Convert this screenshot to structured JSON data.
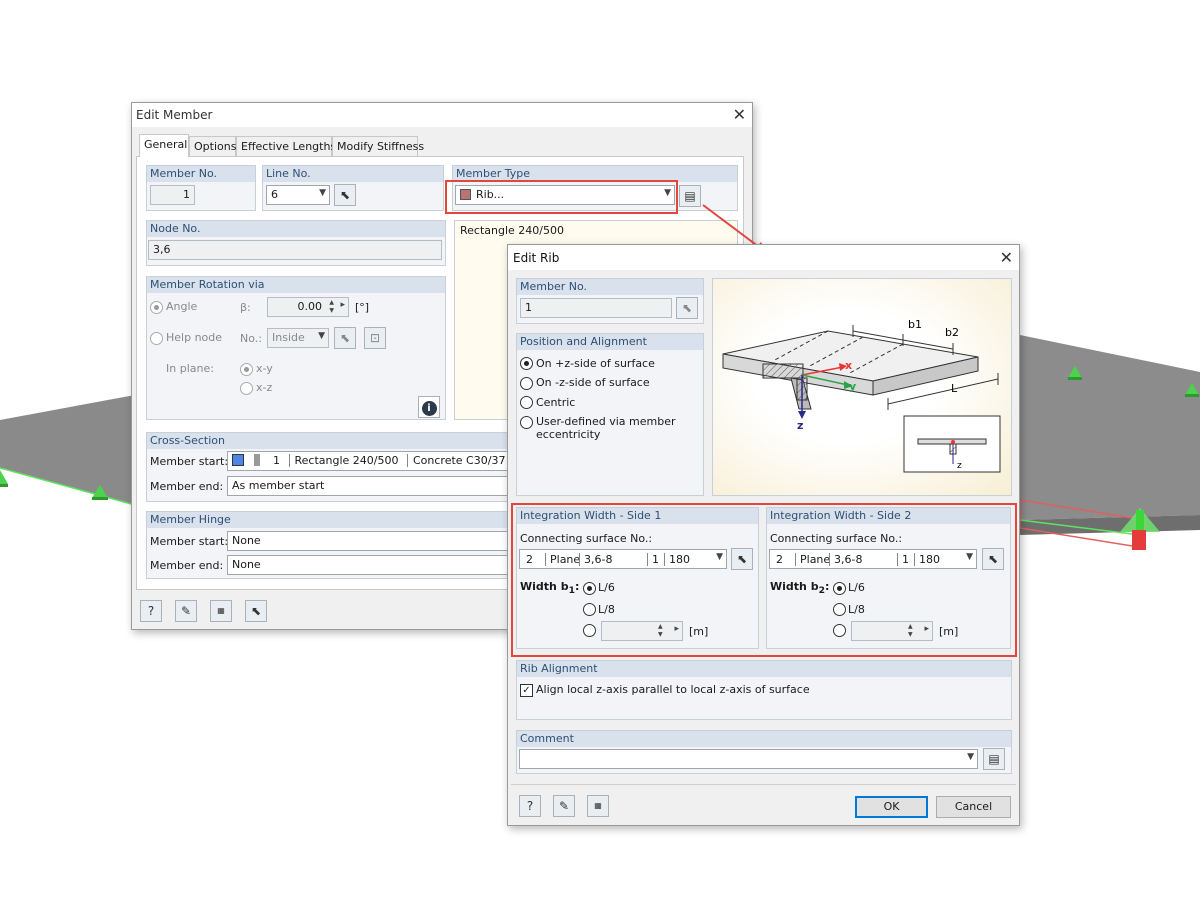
{
  "edit_member": {
    "title": "Edit Member",
    "tabs": [
      "General",
      "Options",
      "Effective Lengths",
      "Modify Stiffness"
    ],
    "member_no_label": "Member No.",
    "member_no": "1",
    "line_no_label": "Line No.",
    "line_no": "6",
    "member_type_label": "Member Type",
    "member_type": "Rib...",
    "node_no_label": "Node No.",
    "node_no": "3,6",
    "info_text": "Rectangle 240/500",
    "rotation": {
      "header": "Member Rotation via",
      "angle_label": "Angle",
      "beta_label": "β:",
      "beta_value": "0.00",
      "unit": "[°]",
      "help_node_label": "Help node",
      "no_label": "No.:",
      "no_value": "Inside",
      "in_plane_label": "In plane:",
      "xy": "x-y",
      "xz": "x-z"
    },
    "cross_section": {
      "header": "Cross-Section",
      "start_label": "Member start:",
      "start_no": "1",
      "start_name": "Rectangle 240/500",
      "start_material": "Concrete C30/37",
      "end_label": "Member end:",
      "end_value": "As member start"
    },
    "hinge": {
      "header": "Member Hinge",
      "start_label": "Member start:",
      "start_value": "None",
      "end_label": "Member end:",
      "end_value": "None"
    }
  },
  "edit_rib": {
    "title": "Edit Rib",
    "member_no_label": "Member No.",
    "member_no": "1",
    "position": {
      "header": "Position and Alignment",
      "options": [
        "On +z-side of surface",
        "On -z-side of surface",
        "Centric",
        "User-defined via member eccentricity"
      ],
      "selected": 0
    },
    "figure": {
      "b1": "b1",
      "b2": "b2",
      "L": "L",
      "x": "x",
      "y": "y",
      "z": "z",
      "z2": "z"
    },
    "side1": {
      "header": "Integration Width - Side 1",
      "conn_label": "Connecting surface No.:",
      "no": "2",
      "type": "Plane",
      "nodes": "3,6-8",
      "n": "1",
      "val": "180",
      "width_label": "Width b",
      "width_sub": "1",
      "opt1": "L/6",
      "opt2": "L/8",
      "unit": "[m]"
    },
    "side2": {
      "header": "Integration Width - Side 2",
      "conn_label": "Connecting surface No.:",
      "no": "2",
      "type": "Plane",
      "nodes": "3,6-8",
      "n": "1",
      "val": "180",
      "width_label": "Width b",
      "width_sub": "2",
      "opt1": "L/6",
      "opt2": "L/8",
      "unit": "[m]"
    },
    "rib_alignment": {
      "header": "Rib Alignment",
      "checkbox_label": "Align local z-axis parallel to local z-axis of surface",
      "checked": true
    },
    "comment": {
      "header": "Comment",
      "value": ""
    },
    "ok_label": "OK",
    "cancel_label": "Cancel"
  },
  "colors": {
    "accent_red": "#e2463c",
    "group_header": "#d9e1ec",
    "support_green": "#3ec93e",
    "cross_section_color": "#4f86e6",
    "rib_color": "#b87373"
  }
}
